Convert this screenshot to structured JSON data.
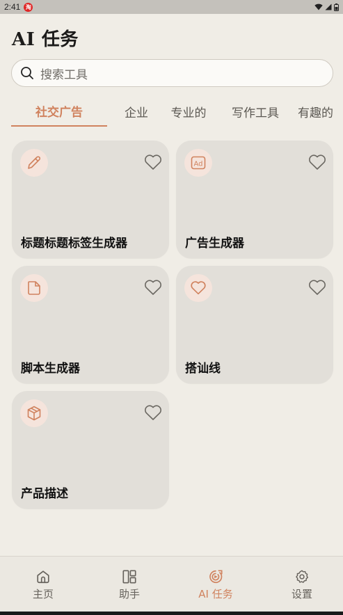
{
  "status_bar": {
    "time": "2:41",
    "notif_glyph": "淘"
  },
  "header": {
    "title": "AI 任务"
  },
  "search": {
    "placeholder": "搜索工具"
  },
  "tabs": [
    {
      "label": "社交广告",
      "active": true
    },
    {
      "label": "企业",
      "active": false
    },
    {
      "label": "专业的",
      "active": false
    },
    {
      "label": "写作工具",
      "active": false
    },
    {
      "label": "有趣的",
      "active": false
    }
  ],
  "cards": [
    {
      "label": "标题标题标签生成器",
      "icon": "pencil-icon"
    },
    {
      "label": "广告生成器",
      "icon": "ad-icon"
    },
    {
      "label": "脚本生成器",
      "icon": "document-icon"
    },
    {
      "label": "搭讪线",
      "icon": "heart-icon"
    },
    {
      "label": "产品描述",
      "icon": "box-icon"
    }
  ],
  "bottom_nav": [
    {
      "label": "主页",
      "icon": "home-icon",
      "active": false
    },
    {
      "label": "助手",
      "icon": "layout-icon",
      "active": false
    },
    {
      "label": "AI 任务",
      "icon": "ai-task-icon",
      "active": true
    },
    {
      "label": "设置",
      "icon": "settings-icon",
      "active": false
    }
  ],
  "colors": {
    "accent": "#d0825e",
    "background": "#f0ede6",
    "card": "#e2dfd9"
  }
}
